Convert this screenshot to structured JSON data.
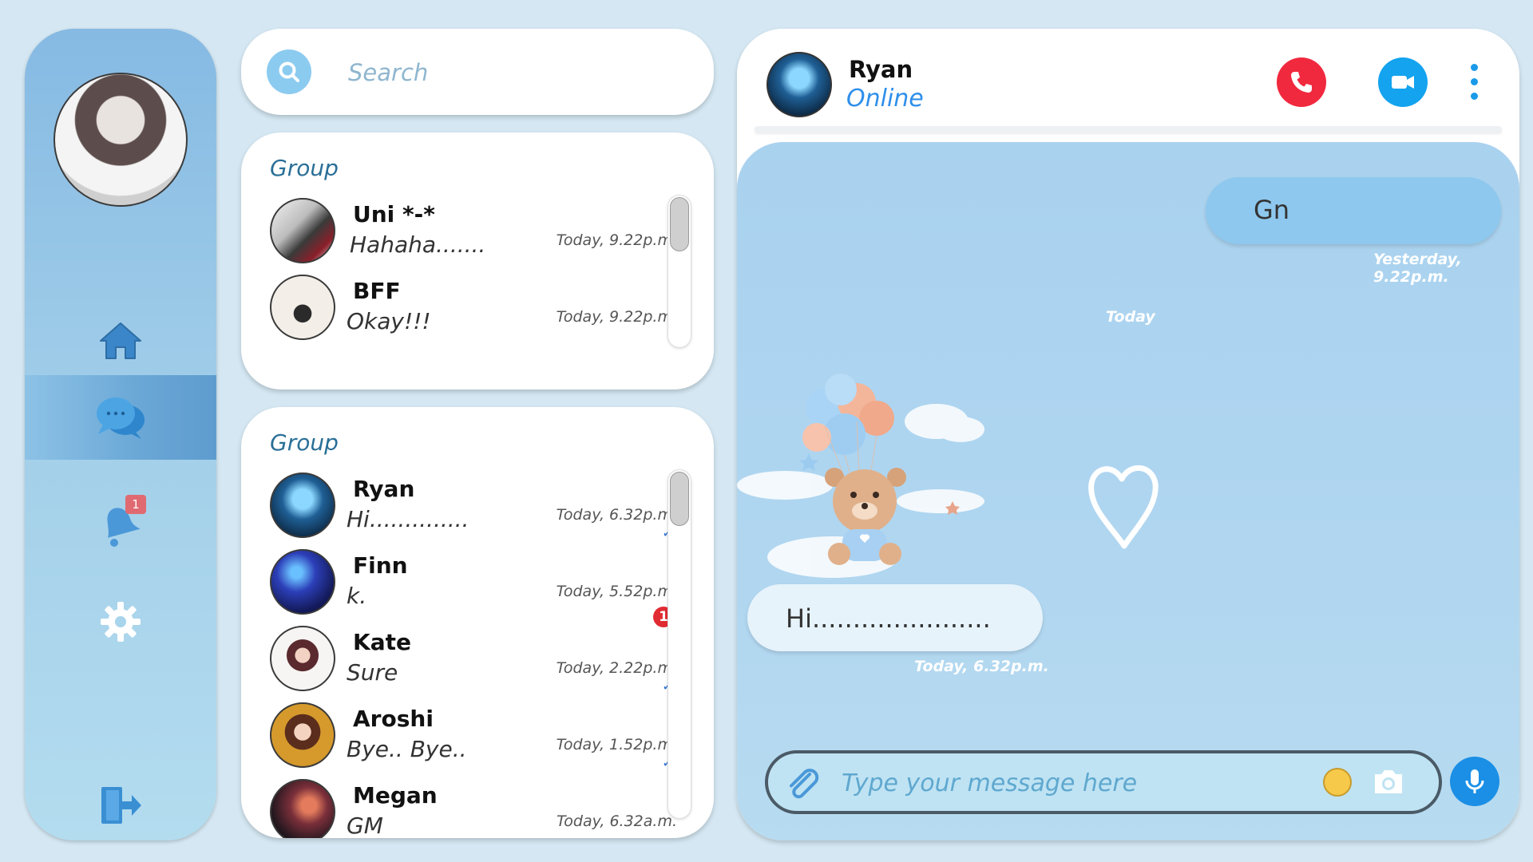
{
  "sidebar": {
    "nav": [
      {
        "id": "home",
        "icon": "home-icon"
      },
      {
        "id": "chats",
        "icon": "chat-bubbles-icon",
        "active": true
      },
      {
        "id": "notifications",
        "icon": "bell-icon",
        "badge": "1"
      },
      {
        "id": "settings",
        "icon": "gear-icon"
      },
      {
        "id": "logout",
        "icon": "logout-icon"
      }
    ]
  },
  "search": {
    "placeholder": "Search"
  },
  "groups": [
    {
      "title": "Group",
      "chats": [
        {
          "name": "Uni *-*",
          "message": "Hahaha.......",
          "time": "Today, 9.22p.m."
        },
        {
          "name": "BFF",
          "message": "Okay!!!",
          "time": "Today, 9.22p.m."
        }
      ]
    },
    {
      "title": "Group",
      "chats": [
        {
          "name": "Ryan",
          "message": "Hi..............",
          "time": "Today, 6.32p.m.",
          "read": true
        },
        {
          "name": "Finn",
          "message": "k.",
          "time": "Today, 5.52p.m.",
          "unread": "1"
        },
        {
          "name": "Kate",
          "message": "Sure",
          "time": "Today, 2.22p.m.",
          "read": true
        },
        {
          "name": "Aroshi",
          "message": "Bye.. Bye..",
          "time": "Today, 1.52p.m.",
          "read": true
        },
        {
          "name": "Megan",
          "message": "GM",
          "time": "Today, 6.32a.m."
        }
      ]
    }
  ],
  "conversation": {
    "contact_name": "Ryan",
    "status": "Online",
    "messages": [
      {
        "direction": "outgoing",
        "text": "Gn",
        "time": "Yesterday, 9.22p.m."
      },
      {
        "direction": "incoming",
        "text": "Hi......................",
        "time": "Today, 6.32p.m."
      }
    ],
    "day_separator": "Today",
    "input_placeholder": "Type your message here"
  },
  "colors": {
    "accent": "#2f8fea",
    "call": "#f1293e",
    "video": "#13a3ef",
    "unread_badge": "#e12b33"
  }
}
